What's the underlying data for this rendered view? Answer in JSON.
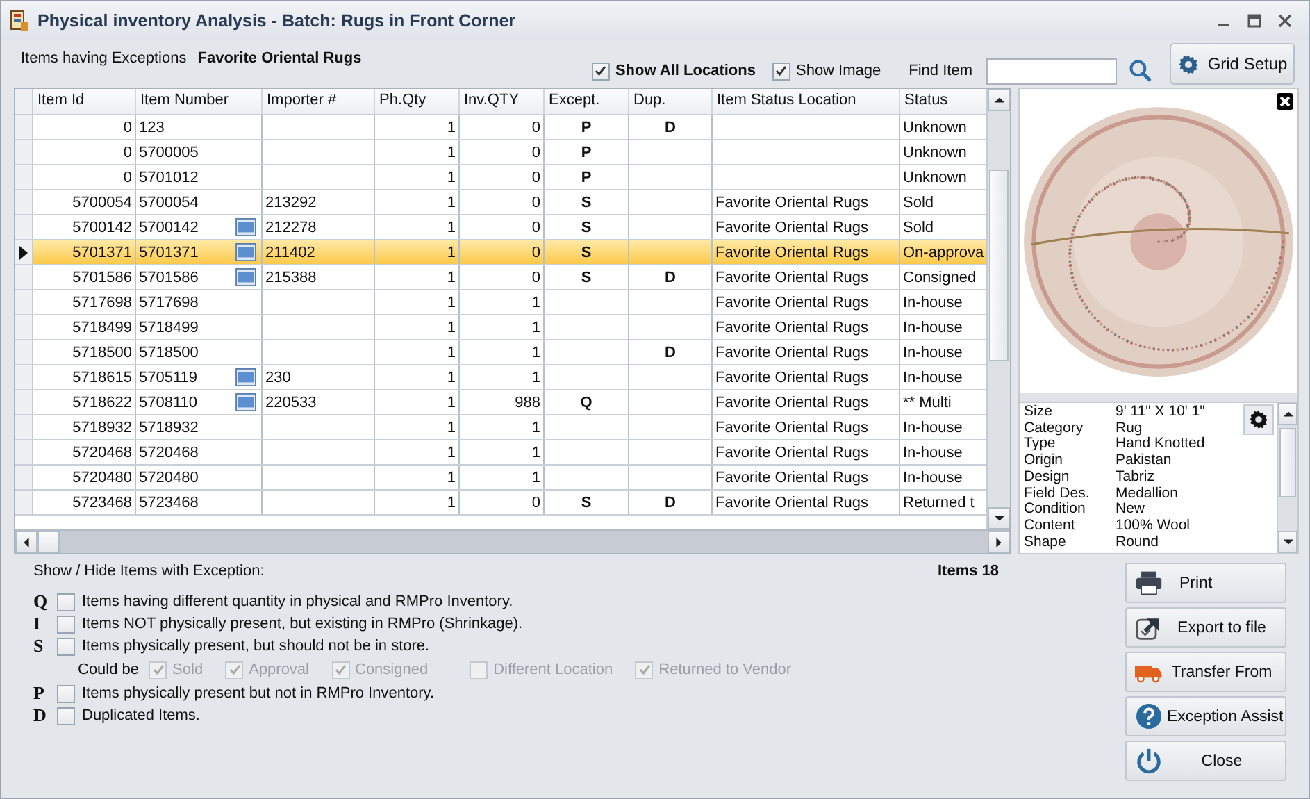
{
  "window": {
    "title": "Physical inventory Analysis - Batch: Rugs in Front Corner"
  },
  "header": {
    "label": "Items having Exceptions",
    "location": "Favorite Oriental Rugs"
  },
  "options": [
    {
      "label": "Show All Locations",
      "checked": true,
      "bold": true
    },
    {
      "label": "Show Image",
      "checked": true,
      "bold": false
    }
  ],
  "find": {
    "label": "Find Item"
  },
  "grid_setup": {
    "label": "Grid Setup"
  },
  "table": {
    "columns": [
      "Item Id",
      "Item Number",
      "Importer #",
      "Ph.Qty",
      "Inv.QTY",
      "Except.",
      "Dup.",
      "Item Status Location",
      "Status"
    ],
    "rows": [
      {
        "item_id": "0",
        "item_number": "123",
        "image": false,
        "importer": "",
        "ph_qty": "1",
        "inv_qty": "0",
        "except": "P",
        "dup": "D",
        "location": "",
        "status": "Unknown",
        "selected": false
      },
      {
        "item_id": "0",
        "item_number": "5700005",
        "image": false,
        "importer": "",
        "ph_qty": "1",
        "inv_qty": "0",
        "except": "P",
        "dup": "",
        "location": "",
        "status": "Unknown",
        "selected": false
      },
      {
        "item_id": "0",
        "item_number": "5701012",
        "image": false,
        "importer": "",
        "ph_qty": "1",
        "inv_qty": "0",
        "except": "P",
        "dup": "",
        "location": "",
        "status": "Unknown",
        "selected": false
      },
      {
        "item_id": "5700054",
        "item_number": "5700054",
        "image": false,
        "importer": "213292",
        "ph_qty": "1",
        "inv_qty": "0",
        "except": "S",
        "dup": "",
        "location": "Favorite Oriental Rugs",
        "status": "Sold",
        "selected": false
      },
      {
        "item_id": "5700142",
        "item_number": "5700142",
        "image": true,
        "importer": "212278",
        "ph_qty": "1",
        "inv_qty": "0",
        "except": "S",
        "dup": "",
        "location": "Favorite Oriental Rugs",
        "status": "Sold",
        "selected": false
      },
      {
        "item_id": "5701371",
        "item_number": "5701371",
        "image": true,
        "importer": "211402",
        "ph_qty": "1",
        "inv_qty": "0",
        "except": "S",
        "dup": "",
        "location": "Favorite Oriental Rugs",
        "status": "On-approva",
        "selected": true
      },
      {
        "item_id": "5701586",
        "item_number": "5701586",
        "image": true,
        "importer": "215388",
        "ph_qty": "1",
        "inv_qty": "0",
        "except": "S",
        "dup": "D",
        "location": "Favorite Oriental Rugs",
        "status": "Consigned",
        "selected": false
      },
      {
        "item_id": "5717698",
        "item_number": "5717698",
        "image": false,
        "importer": "",
        "ph_qty": "1",
        "inv_qty": "1",
        "except": "",
        "dup": "",
        "location": "Favorite Oriental Rugs",
        "status": "In-house",
        "selected": false
      },
      {
        "item_id": "5718499",
        "item_number": "5718499",
        "image": false,
        "importer": "",
        "ph_qty": "1",
        "inv_qty": "1",
        "except": "",
        "dup": "",
        "location": "Favorite Oriental Rugs",
        "status": "In-house",
        "selected": false
      },
      {
        "item_id": "5718500",
        "item_number": "5718500",
        "image": false,
        "importer": "",
        "ph_qty": "1",
        "inv_qty": "1",
        "except": "",
        "dup": "D",
        "location": "Favorite Oriental Rugs",
        "status": "In-house",
        "selected": false
      },
      {
        "item_id": "5718615",
        "item_number": "5705119",
        "image": true,
        "importer": "230",
        "ph_qty": "1",
        "inv_qty": "1",
        "except": "",
        "dup": "",
        "location": "Favorite Oriental Rugs",
        "status": "In-house",
        "selected": false
      },
      {
        "item_id": "5718622",
        "item_number": "5708110",
        "image": true,
        "importer": "220533",
        "ph_qty": "1",
        "inv_qty": "988",
        "except": "Q",
        "dup": "",
        "location": "Favorite Oriental Rugs",
        "status": "** Multi",
        "selected": false
      },
      {
        "item_id": "5718932",
        "item_number": "5718932",
        "image": false,
        "importer": "",
        "ph_qty": "1",
        "inv_qty": "1",
        "except": "",
        "dup": "",
        "location": "Favorite Oriental Rugs",
        "status": "In-house",
        "selected": false
      },
      {
        "item_id": "5720468",
        "item_number": "5720468",
        "image": false,
        "importer": "",
        "ph_qty": "1",
        "inv_qty": "1",
        "except": "",
        "dup": "",
        "location": "Favorite Oriental Rugs",
        "status": "In-house",
        "selected": false
      },
      {
        "item_id": "5720480",
        "item_number": "5720480",
        "image": false,
        "importer": "",
        "ph_qty": "1",
        "inv_qty": "1",
        "except": "",
        "dup": "",
        "location": "Favorite Oriental Rugs",
        "status": "In-house",
        "selected": false
      },
      {
        "item_id": "5723468",
        "item_number": "5723468",
        "image": false,
        "importer": "",
        "ph_qty": "1",
        "inv_qty": "0",
        "except": "S",
        "dup": "D",
        "location": "Favorite Oriental Rugs",
        "status": "Returned t",
        "selected": false
      }
    ]
  },
  "details": [
    {
      "label": "Size",
      "value": "9' 11\" X 10' 1\""
    },
    {
      "label": "Category",
      "value": "Rug"
    },
    {
      "label": "Type",
      "value": "Hand Knotted"
    },
    {
      "label": "Origin",
      "value": "Pakistan"
    },
    {
      "label": "Design",
      "value": "Tabriz"
    },
    {
      "label": "Field Des.",
      "value": "Medallion"
    },
    {
      "label": "Condition",
      "value": "New"
    },
    {
      "label": "Content",
      "value": "100% Wool"
    },
    {
      "label": "Shape",
      "value": "Round"
    }
  ],
  "filter": {
    "title": "Show / Hide Items with Exception:",
    "count": "Items 18",
    "exceptions": [
      {
        "code": "Q",
        "label": "Items having different quantity in physical and RMPro Inventory.",
        "checked": false
      },
      {
        "code": "I",
        "label": "Items NOT physically present, but existing in RMPro (Shrinkage).",
        "checked": false
      },
      {
        "code": "S",
        "label": "Items physically present, but should not be in store.",
        "checked": false,
        "could_be": {
          "label": "Could be",
          "options": [
            {
              "label": "Sold",
              "checked": true,
              "disabled": true
            },
            {
              "label": "Approval",
              "checked": true,
              "disabled": true
            },
            {
              "label": "Consigned",
              "checked": true,
              "disabled": true
            },
            {
              "label": "Different Location",
              "checked": false,
              "disabled": true
            },
            {
              "label": "Returned to Vendor",
              "checked": true,
              "disabled": true
            }
          ]
        }
      },
      {
        "code": "P",
        "label": "Items physically present but not in RMPro Inventory.",
        "checked": false
      },
      {
        "code": "D",
        "label": "Duplicated Items.",
        "checked": false
      }
    ]
  },
  "buttons": [
    {
      "label": "Print",
      "kind": "print"
    },
    {
      "label": "Export to file",
      "kind": "export"
    },
    {
      "label": "Transfer From",
      "kind": "transfer"
    },
    {
      "label": "Exception Assist",
      "kind": "assist"
    },
    {
      "label": "Close",
      "kind": "close"
    }
  ]
}
